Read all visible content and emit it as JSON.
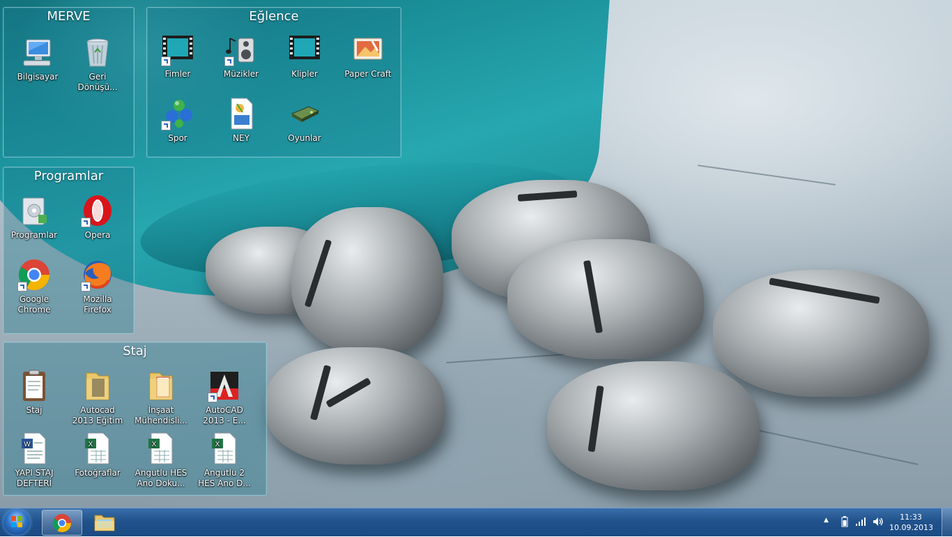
{
  "desktop": {
    "fences": [
      {
        "title": "MERVE",
        "icons": [
          {
            "label": "Bilgisayar",
            "icon": "computer-icon"
          },
          {
            "label": "Geri Dönüşü...",
            "icon": "recycle-bin-icon"
          }
        ]
      },
      {
        "title": "Eğlence",
        "icons": [
          {
            "label": "Fimler",
            "icon": "film-strip-icon"
          },
          {
            "label": "Müzikler",
            "icon": "music-speaker-icon"
          },
          {
            "label": "Klipler",
            "icon": "film-strip-icon"
          },
          {
            "label": "Paper Craft",
            "icon": "paper-craft-icon"
          },
          {
            "label": "Spor",
            "icon": "molecule-icon"
          },
          {
            "label": "NEY",
            "icon": "media-file-icon"
          },
          {
            "label": "Oyunlar",
            "icon": "game-drive-icon"
          }
        ]
      },
      {
        "title": "Programlar",
        "icons": [
          {
            "label": "Programlar",
            "icon": "programs-icon"
          },
          {
            "label": "Opera",
            "icon": "opera-icon"
          },
          {
            "label": "Google Chrome",
            "icon": "chrome-icon"
          },
          {
            "label": "Mozilla Firefox",
            "icon": "firefox-icon"
          }
        ]
      },
      {
        "title": "Staj",
        "icons": [
          {
            "label": "Staj",
            "icon": "clipboard-icon"
          },
          {
            "label": "Autocad 2013 Eğitim",
            "icon": "folder-icon"
          },
          {
            "label": "İnşaat Mühendisli...",
            "icon": "folder-icon"
          },
          {
            "label": "AutoCAD 2013 - E...",
            "icon": "autocad-icon"
          },
          {
            "label": "YAPI STAJ DEFTERİ",
            "icon": "word-document-icon"
          },
          {
            "label": "Fotoğraflar",
            "icon": "excel-document-icon"
          },
          {
            "label": "Angutlu HES Ano Doku...",
            "icon": "excel-document-icon"
          },
          {
            "label": "Angutlu 2 HES Ano D...",
            "icon": "excel-document-icon"
          }
        ]
      }
    ]
  },
  "taskbar": {
    "start_icon": "windows-start-icon",
    "pinned": [
      {
        "icon": "chrome-icon",
        "active": true
      },
      {
        "icon": "file-explorer-icon",
        "active": false
      }
    ],
    "tray": {
      "icons": [
        "show-hidden-icons-icon",
        "battery-icon",
        "network-signal-icon",
        "volume-icon"
      ],
      "time": "11:33",
      "date": "10.09.2013"
    }
  }
}
